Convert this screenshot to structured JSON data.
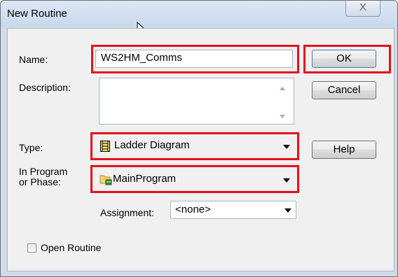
{
  "dialog": {
    "title": "New Routine",
    "close_glyph": "X"
  },
  "form": {
    "name_label": "Name:",
    "name_value": "WS2HM_Comms",
    "description_label": "Description:",
    "description_value": "",
    "type_label": "Type:",
    "type_value": "Ladder Diagram",
    "type_icon": "ladder-diagram-icon",
    "program_label_line1": "In Program",
    "program_label_line2": "or Phase:",
    "program_value": "MainProgram",
    "program_icon": "folder-program-icon",
    "assignment_label": "Assignment:",
    "assignment_value": "<none>",
    "open_routine_label": "Open Routine",
    "open_routine_checked": false
  },
  "buttons": {
    "ok": "OK",
    "cancel": "Cancel",
    "help": "Help"
  },
  "colors": {
    "highlight": "#e3111c",
    "window_frame": "#cfdcec",
    "dialog_background": "#f0f0f0"
  }
}
